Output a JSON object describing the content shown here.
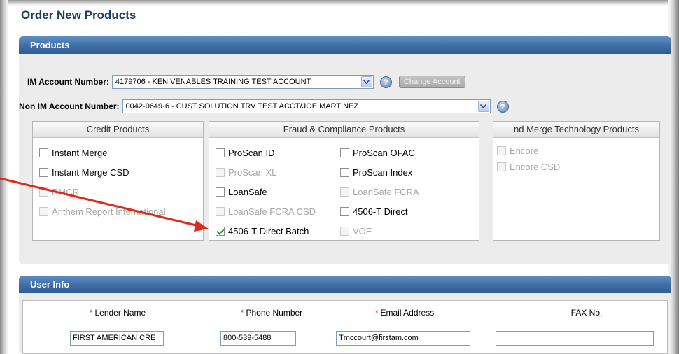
{
  "page": {
    "title": "Order New Products"
  },
  "products": {
    "header": "Products",
    "im_account": {
      "label": "IM Account Number:",
      "value": "4179706 - KEN VENABLES TRAINING TEST ACCOUNT",
      "help_icon": "help-icon",
      "change_button": "Change Account"
    },
    "non_im_account": {
      "label": "Non IM Account Number:",
      "value": "0042-0649-6  -  CUST SOLUTION TRV TEST ACCT/JOE MARTINEZ",
      "help_icon": "help-icon"
    },
    "groups": {
      "credit": {
        "title": "Credit Products",
        "items": [
          {
            "label": "Instant Merge",
            "checked": false,
            "disabled": false
          },
          {
            "label": "Instant Merge CSD",
            "checked": false,
            "disabled": false
          },
          {
            "label": "RMCR",
            "checked": false,
            "disabled": true
          },
          {
            "label": "Anthem Report International",
            "checked": false,
            "disabled": true
          }
        ]
      },
      "fraud": {
        "title": "Fraud & Compliance Products",
        "items": [
          {
            "label": "ProScan ID",
            "checked": false,
            "disabled": false
          },
          {
            "label": "ProScan OFAC",
            "checked": false,
            "disabled": false
          },
          {
            "label": "ProScan XL",
            "checked": false,
            "disabled": true
          },
          {
            "label": "ProScan Index",
            "checked": false,
            "disabled": false
          },
          {
            "label": "LoanSafe",
            "checked": false,
            "disabled": false
          },
          {
            "label": "LoanSafe FCRA",
            "checked": false,
            "disabled": true
          },
          {
            "label": "LoanSafe FCRA CSD",
            "checked": false,
            "disabled": true
          },
          {
            "label": "4506-T Direct",
            "checked": false,
            "disabled": false
          },
          {
            "label": "4506-T Direct Batch",
            "checked": true,
            "disabled": false
          },
          {
            "label": "VOE",
            "checked": false,
            "disabled": true
          }
        ]
      },
      "merge": {
        "title": "nd Merge Technology Products",
        "items": [
          {
            "label": "Encore",
            "checked": false,
            "disabled": true
          },
          {
            "label": "Encore CSD",
            "checked": false,
            "disabled": true
          }
        ]
      }
    }
  },
  "user_info": {
    "header": "User Info",
    "required_mark": "*",
    "fields": {
      "lender_name": {
        "label": "Lender Name",
        "value": "FIRST AMERICAN CRE",
        "required": true
      },
      "phone": {
        "label": "Phone Number",
        "value": "800-539-5488",
        "required": true
      },
      "email": {
        "label": "Email Address",
        "value": "Tmccourt@firstam.com",
        "required": true
      },
      "fax": {
        "label": "FAX No.",
        "value": "",
        "required": false
      }
    }
  },
  "annotation": {
    "arrow_color": "#e0281c"
  }
}
